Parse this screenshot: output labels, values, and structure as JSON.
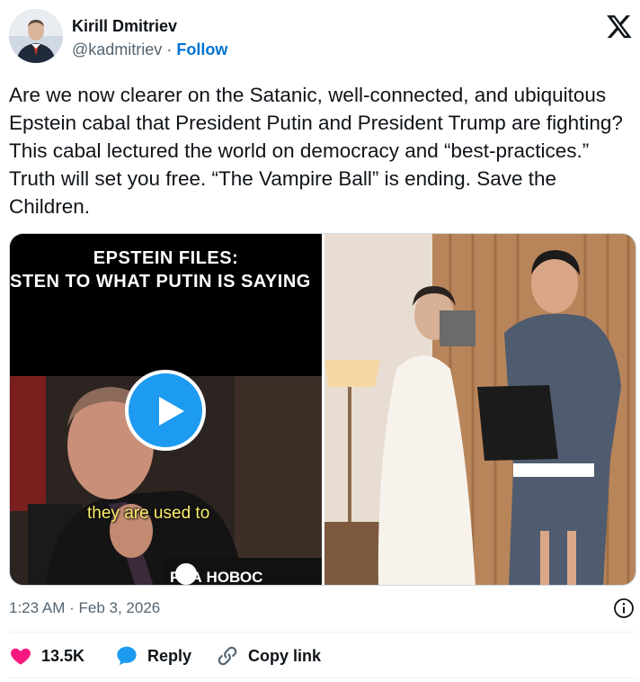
{
  "author": {
    "name": "Kirill Dmitriev",
    "handle": "@kadmitriev",
    "separator": "·",
    "follow_label": "Follow"
  },
  "tweet": {
    "text": "Are we now clearer on the Satanic, well-connected, and ubiquitous Epstein cabal that President Putin and President Trump are fighting?  This cabal lectured the world on democracy and “best-practices.”  Truth will set you free. “The Vampire Ball” is ending. Save the Children."
  },
  "media": {
    "video": {
      "caption_line1": "EPSTEIN FILES:",
      "caption_line2": "ISTEN TO WHAT PUTIN IS SAYING",
      "subtitle": "they are used to",
      "watermark": "РИА НОВОС"
    }
  },
  "meta": {
    "time": "1:23 AM",
    "separator": "·",
    "date": "Feb 3, 2026"
  },
  "actions": {
    "likes": "13.5K",
    "reply_label": "Reply",
    "copy_label": "Copy link"
  },
  "icons": {
    "logo": "x-logo-icon",
    "play": "play-icon",
    "info": "info-icon",
    "like": "heart-icon",
    "reply": "speech-bubble-icon",
    "copy": "link-icon"
  },
  "colors": {
    "accent": "#1d9bf0",
    "follow": "#0074d3",
    "like": "#f91880",
    "muted": "#536471",
    "text": "#0f1419"
  }
}
